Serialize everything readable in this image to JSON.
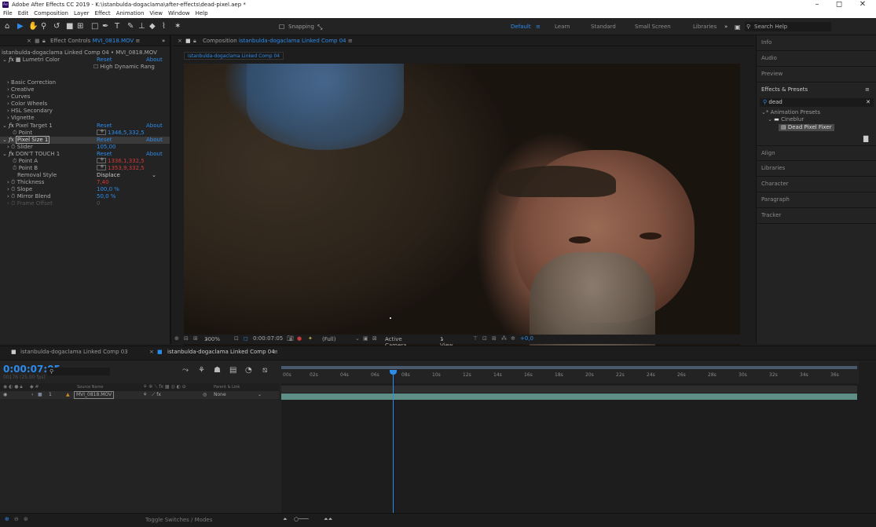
{
  "window": {
    "title": "Adobe After Effects CC 2019 - K:\\istanbulda-dogaclama\\after-effects\\dead-pixel.aep *",
    "minimize": "–",
    "maximize": "◻",
    "close": "✕"
  },
  "menu": [
    "File",
    "Edit",
    "Composition",
    "Layer",
    "Effect",
    "Animation",
    "View",
    "Window",
    "Help"
  ],
  "toolbar": {
    "snapping": "Snapping",
    "workspaces": [
      "Default",
      "Learn",
      "Standard",
      "Small Screen",
      "Libraries"
    ],
    "active_workspace": "Default",
    "more": "»",
    "search_placeholder": "Search Help"
  },
  "effect_controls": {
    "tab_prefix": "Effect Controls",
    "tab_file": "MVI_0818.MOV",
    "tab_menu": "≡",
    "overflow": "»",
    "header": "istanbulda-dogaclama Linked Comp 04 • MVI_0818.MOV",
    "lumetri": {
      "name": "Lumetri Color",
      "reset": "Reset",
      "about": "About",
      "hdr": "High Dynamic Rang"
    },
    "lumetri_groups": [
      "Basic Correction",
      "Creative",
      "Curves",
      "Color Wheels",
      "HSL Secondary",
      "Vignette"
    ],
    "pixel_target": {
      "name": "Pixel Target 1",
      "reset": "Reset",
      "about": "About",
      "point_label": "Point",
      "point_value": "1346,5,332,5"
    },
    "pixel_size": {
      "name": "Pixel Size 1",
      "reset": "Reset",
      "about": "About",
      "slider_label": "Slider",
      "slider_value": "105,00"
    },
    "dont_touch": {
      "name": "DON'T TOUCH 1",
      "reset": "Reset",
      "about": "About",
      "point_a_label": "Point A",
      "point_a_value": "1336,1,332,5",
      "point_b_label": "Point B",
      "point_b_value": "1353,9,332,5",
      "removal_label": "Removal Style",
      "removal_value": "Displace",
      "thickness_label": "Thickness",
      "thickness_value": "7,40",
      "slope_label": "Slope",
      "slope_value": "100,0 %",
      "mirror_label": "Mirror Blend",
      "mirror_value": "50,0 %",
      "frame_offset_label": "Frame Offset",
      "frame_offset_value": "0"
    }
  },
  "composition": {
    "tab_prefix": "Composition",
    "tab_name": "istanbulda-dogaclama Linked Comp 04",
    "tab_menu": "≡",
    "sub_tab": "istanbulda-dogaclama Linked Comp 04",
    "zoom": "300%",
    "timecode": "0:00:07:05",
    "resolution": "(Full)",
    "camera": "Active Camera",
    "view": "1 View",
    "exposure": "+0,0"
  },
  "right_panel": {
    "items": [
      "Info",
      "Audio",
      "Preview",
      "Effects & Presets",
      "Align",
      "Libraries",
      "Character",
      "Paragraph",
      "Tracker"
    ],
    "effects_menu": "≡",
    "search_value": "dead",
    "clear": "✕",
    "tree": {
      "root": "* Animation Presets",
      "folder": "Cineblur",
      "item": "Dead Pixel Fixer"
    }
  },
  "timeline": {
    "tabs": [
      "istanbulda-dogaclama Linked Comp 03",
      "istanbulda-dogaclama Linked Comp 04"
    ],
    "tab_menu": "≡",
    "timecode": "0:00:07:05",
    "fps": "00176 (25.00 fps)",
    "search_placeholder": "",
    "columns": {
      "source_name": "Source Name",
      "parent": "Parent & Link"
    },
    "layer": {
      "index": "1",
      "name": "MVI_0818.MOV",
      "parent": "None"
    },
    "ruler": [
      "00s",
      "02s",
      "04s",
      "06s",
      "08s",
      "10s",
      "12s",
      "14s",
      "16s",
      "18s",
      "20s",
      "22s",
      "24s",
      "26s",
      "28s",
      "30s",
      "32s",
      "34s",
      "36s"
    ],
    "toggle": "Toggle Switches / Modes"
  }
}
